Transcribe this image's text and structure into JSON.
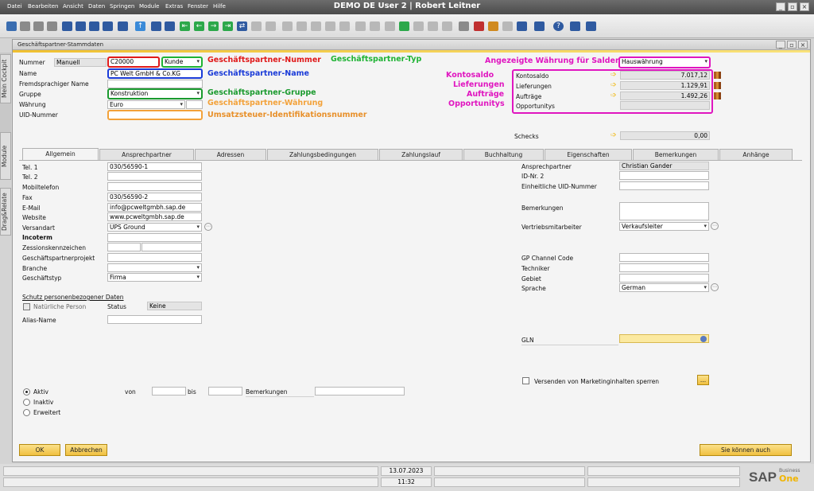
{
  "window": {
    "title": "DEMO DE User 2 | Robert Leitner"
  },
  "menu": [
    "Datei",
    "Bearbeiten",
    "Ansicht",
    "Daten",
    "Springen",
    "Module",
    "Extras",
    "Fenster",
    "Hilfe"
  ],
  "side_tabs": [
    "Mein Cockpit",
    "Module",
    "Drag&Relate"
  ],
  "form": {
    "title": "Geschäftspartner-Stammdaten"
  },
  "header": {
    "nummer_label": "Nummer",
    "nummer_mode": "Manuell",
    "nummer_value": "C20000",
    "typ_value": "Kunde",
    "name_label": "Name",
    "name_value": "PC Welt GmbH & Co.KG",
    "fremd_label": "Fremdsprachiger Name",
    "gruppe_label": "Gruppe",
    "gruppe_value": "Konstruktion",
    "waehrung_label": "Währung",
    "waehrung_value": "Euro",
    "uid_label": "UID-Nummer"
  },
  "annotations": {
    "nummer": "Geschäftspartner-Nummer",
    "typ": "Geschäftspartner-Typ",
    "name": "Geschäftspartner-Name",
    "gruppe": "Geschäftspartner-Gruppe",
    "waehrung": "Geschäftspartner-Währung",
    "uid": "Umsatzsteuer-Identifikationsnummer",
    "saldenwaehrung": "Angezeigte Währung für Salden",
    "kontosaldo": "Kontosaldo",
    "lieferungen": "Lieferungen",
    "auftraege": "Aufträge",
    "opportunitys": "Opportunitys"
  },
  "balances": {
    "currency_value": "Hauswährung",
    "kontosaldo_label": "Kontosaldo",
    "kontosaldo_value": "7.017,12",
    "lieferungen_label": "Lieferungen",
    "lieferungen_value": "1.129,91",
    "auftraege_label": "Aufträge",
    "auftraege_value": "1.492,26",
    "opportunitys_label": "Opportunitys",
    "schecks_label": "Schecks",
    "schecks_value": "0,00"
  },
  "tabs": [
    "Allgemein",
    "Ansprechpartner",
    "Adressen",
    "Zahlungsbedingungen",
    "Zahlungslauf",
    "Buchhaltung",
    "Eigenschaften",
    "Bemerkungen",
    "Anhänge"
  ],
  "general_left": {
    "tel1_label": "Tel. 1",
    "tel1_value": "030/56590-1",
    "tel2_label": "Tel. 2",
    "mobil_label": "Mobiltelefon",
    "fax_label": "Fax",
    "fax_value": "030/56590-2",
    "email_label": "E-Mail",
    "email_value": "info@pcweltgmbh.sap.de",
    "website_label": "Website",
    "website_value": "www.pcweltgmbh.sap.de",
    "versandart_label": "Versandart",
    "versandart_value": "UPS Ground",
    "incoterm_label": "Incoterm",
    "zession_label": "Zessionskennzeichen",
    "projekt_label": "Geschäftspartnerprojekt",
    "branche_label": "Branche",
    "typ_label": "Geschäftstyp",
    "typ_value": "Firma",
    "schutz_label": "Schutz personenbezogener Daten",
    "natuerlich_label": "Natürliche Person",
    "status_label": "Status",
    "status_value": "Keine",
    "alias_label": "Alias-Name"
  },
  "general_right": {
    "ansprech_label": "Ansprechpartner",
    "ansprech_value": "Christian Gander",
    "idnr_label": "ID-Nr. 2",
    "einheitlich_label": "Einheitliche UID-Nummer",
    "bemerk_label": "Bemerkungen",
    "vertrieb_label": "Vertriebsmitarbeiter",
    "vertrieb_value": "Verkaufsleiter",
    "channel_label": "GP Channel Code",
    "techniker_label": "Techniker",
    "gebiet_label": "Gebiet",
    "sprache_label": "Sprache",
    "sprache_value": "German",
    "gln_label": "GLN",
    "marketing_label": "Versenden von Marketinginhalten sperren",
    "ellipsis": "..."
  },
  "status_section": {
    "aktiv": "Aktiv",
    "inaktiv": "Inaktiv",
    "erweitert": "Erweitert",
    "von": "von",
    "bis": "bis",
    "bemerkungen": "Bemerkungen"
  },
  "buttons": {
    "ok": "OK",
    "cancel": "Abbrechen",
    "also": "Sie können auch"
  },
  "statusbar": {
    "date": "13.07.2023",
    "time": "11:32",
    "logo": "SAP",
    "logo_business": "Business",
    "logo_one": "One"
  }
}
